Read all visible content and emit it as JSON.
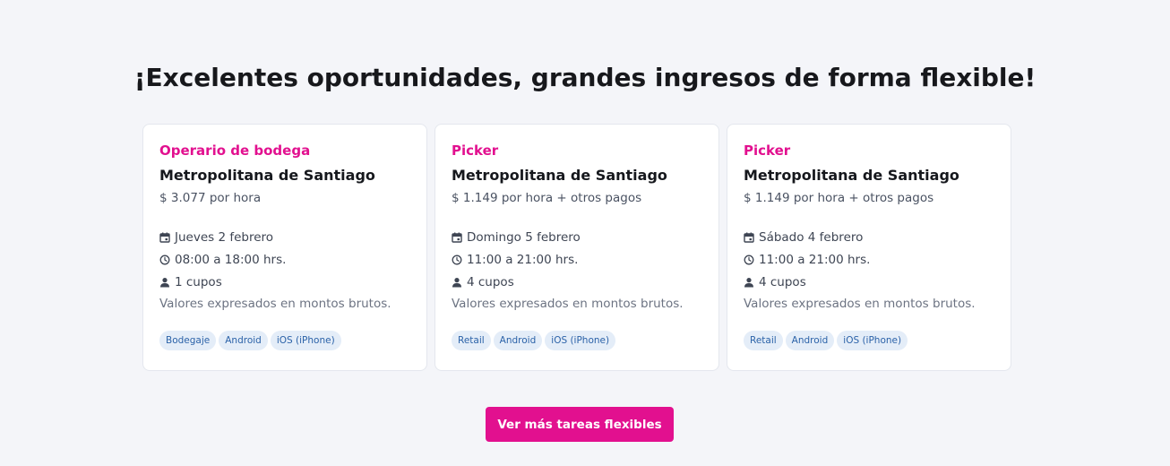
{
  "heading": "¡Excelentes oportunidades, grandes ingresos de forma flexible!",
  "cards": [
    {
      "role": "Operario de bodega",
      "location": "Metropolitana de Santiago",
      "pay": "$ 3.077 por hora",
      "date": "Jueves 2 febrero",
      "time": "08:00 a 18:00 hrs.",
      "spots": "1 cupos",
      "note": "Valores expresados en montos brutos.",
      "tags": [
        "Bodegaje",
        "Android",
        "iOS (iPhone)"
      ]
    },
    {
      "role": "Picker",
      "location": "Metropolitana de Santiago",
      "pay": "$ 1.149 por hora + otros pagos",
      "date": "Domingo 5 febrero",
      "time": "11:00 a 21:00 hrs.",
      "spots": "4 cupos",
      "note": "Valores expresados en montos brutos.",
      "tags": [
        "Retail",
        "Android",
        "iOS (iPhone)"
      ]
    },
    {
      "role": "Picker",
      "location": "Metropolitana de Santiago",
      "pay": "$ 1.149 por hora + otros pagos",
      "date": "Sábado 4 febrero",
      "time": "11:00 a 21:00 hrs.",
      "spots": "4 cupos",
      "note": "Valores expresados en montos brutos.",
      "tags": [
        "Retail",
        "Android",
        "iOS (iPhone)"
      ]
    }
  ],
  "cta_label": "Ver más tareas flexibles",
  "colors": {
    "accent": "#e2108f",
    "tag_bg": "#e4edf8",
    "tag_text": "#2b62a8",
    "page_bg": "#f4f5f9"
  },
  "icons": {
    "date": "calendar-icon",
    "time": "clock-icon",
    "spots": "person-icon"
  }
}
